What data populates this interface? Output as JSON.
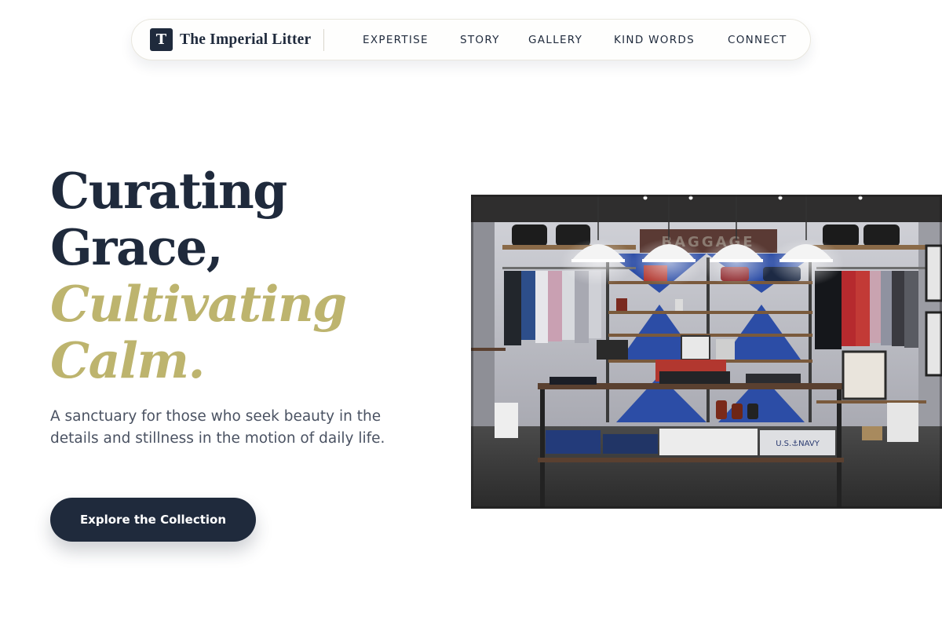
{
  "brand": {
    "logo_letter": "T",
    "name": "The Imperial Litter"
  },
  "nav": {
    "links": [
      "EXPERTISE",
      "STORY",
      "GALLERY",
      "KIND WORDS",
      "CONNECT"
    ]
  },
  "hero": {
    "title_line1": "Curating",
    "title_line2": "Grace,",
    "title_line3": "Cultivating",
    "title_line4": "Calm.",
    "subtitle": "A sanctuary for those who seek beauty in the details and stillness in the motion of daily life.",
    "cta_label": "Explore the Collection"
  },
  "image": {
    "alt": "Boutique store interior with clothing racks, shelves and pendant lamps",
    "sign_text": "BAGGAGE",
    "shirt_text": "U.S.⚓NAVY"
  },
  "colors": {
    "navy": "#1f2a3c",
    "accent_gold": "#bdb46e",
    "body_text": "#4a5262"
  }
}
